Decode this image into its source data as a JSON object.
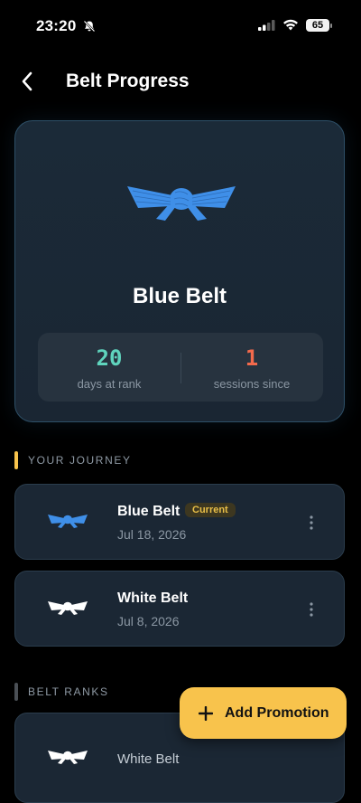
{
  "status": {
    "time": "23:20",
    "battery": "65"
  },
  "nav": {
    "title": "Belt Progress",
    "back_icon": "chevron-left-icon"
  },
  "hero": {
    "belt_color": "#3f8fe8",
    "title": "Blue Belt",
    "stats": [
      {
        "value": "20",
        "label": "days at rank",
        "color": "#5fd4bd"
      },
      {
        "value": "1",
        "label": "sessions since",
        "color": "#f36a4c"
      }
    ]
  },
  "journey": {
    "header": "YOUR JOURNEY",
    "accent": "#f8c34c",
    "items": [
      {
        "title": "Blue Belt",
        "date": "Jul 18, 2026",
        "badge": "Current",
        "belt_color": "#3f8fe8"
      },
      {
        "title": "White Belt",
        "date": "Jul 8, 2026",
        "belt_color": "#ffffff"
      }
    ]
  },
  "ranks": {
    "header": "BELT RANKS",
    "accent": "#4a4f55",
    "items": [
      {
        "title": "White Belt",
        "belt_color": "#ffffff"
      }
    ]
  },
  "fab": {
    "label": "Add Promotion",
    "icon": "plus-icon"
  }
}
